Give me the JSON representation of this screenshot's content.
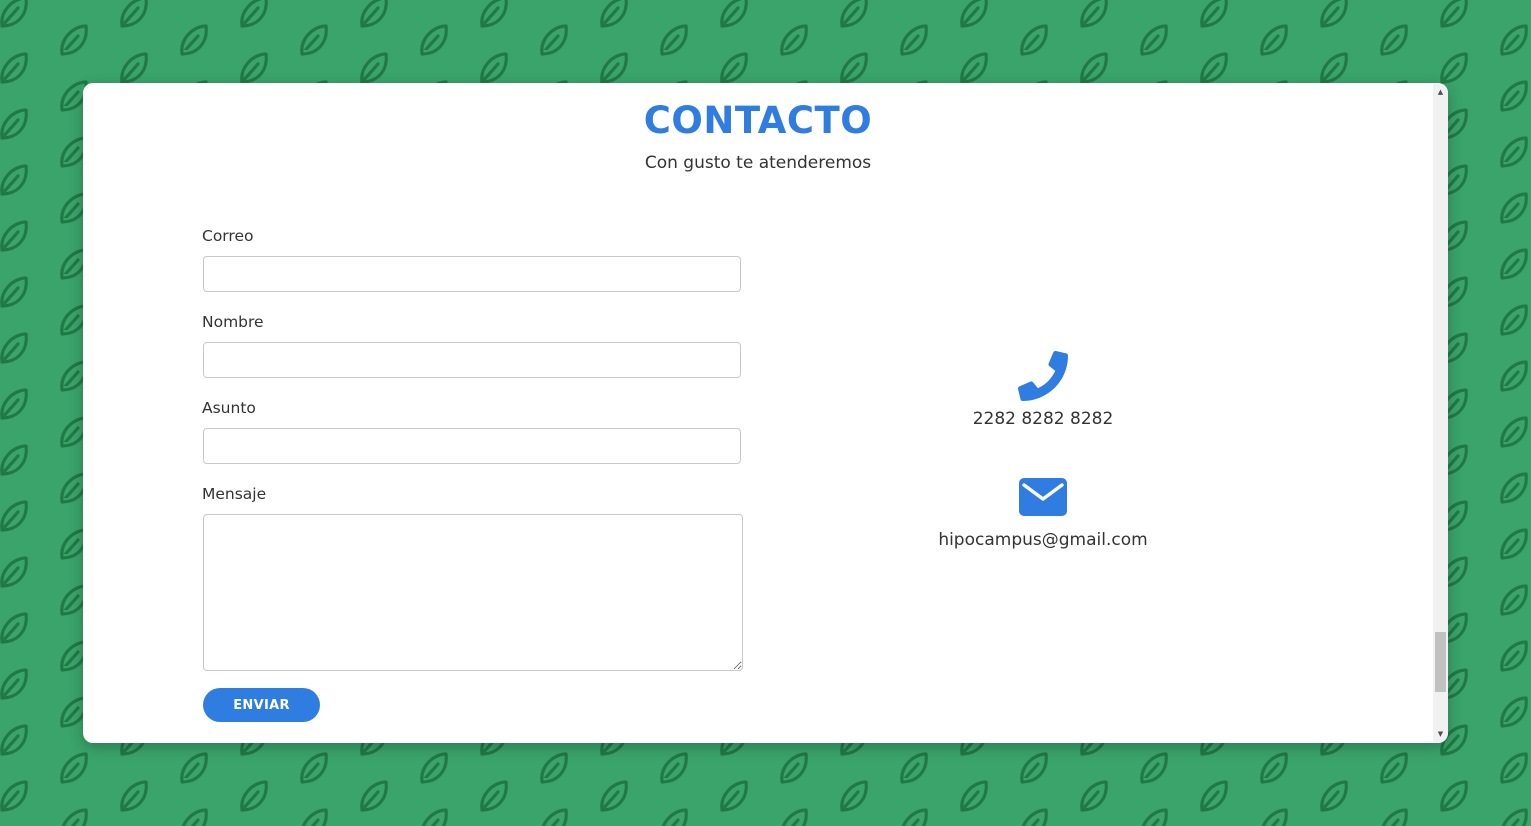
{
  "header": {
    "title": "CONTACTO",
    "subtitle": "Con gusto te atenderemos"
  },
  "form": {
    "email_label": "Correo",
    "email_value": "",
    "name_label": "Nombre",
    "name_value": "",
    "subject_label": "Asunto",
    "subject_value": "",
    "message_label": "Mensaje",
    "message_value": "",
    "submit_label": "ENVIAR"
  },
  "contact": {
    "phone_icon": "phone-icon",
    "phone": "2282 8282 8282",
    "email_icon": "envelope-icon",
    "email": "hipocampus@gmail.com"
  },
  "scrollbar": {
    "up_arrow": "▲",
    "down_arrow": "▼"
  },
  "colors": {
    "accent": "#2f7de1",
    "page_background": "#3aa46a",
    "pattern": "#217a45",
    "text": "#333333"
  }
}
